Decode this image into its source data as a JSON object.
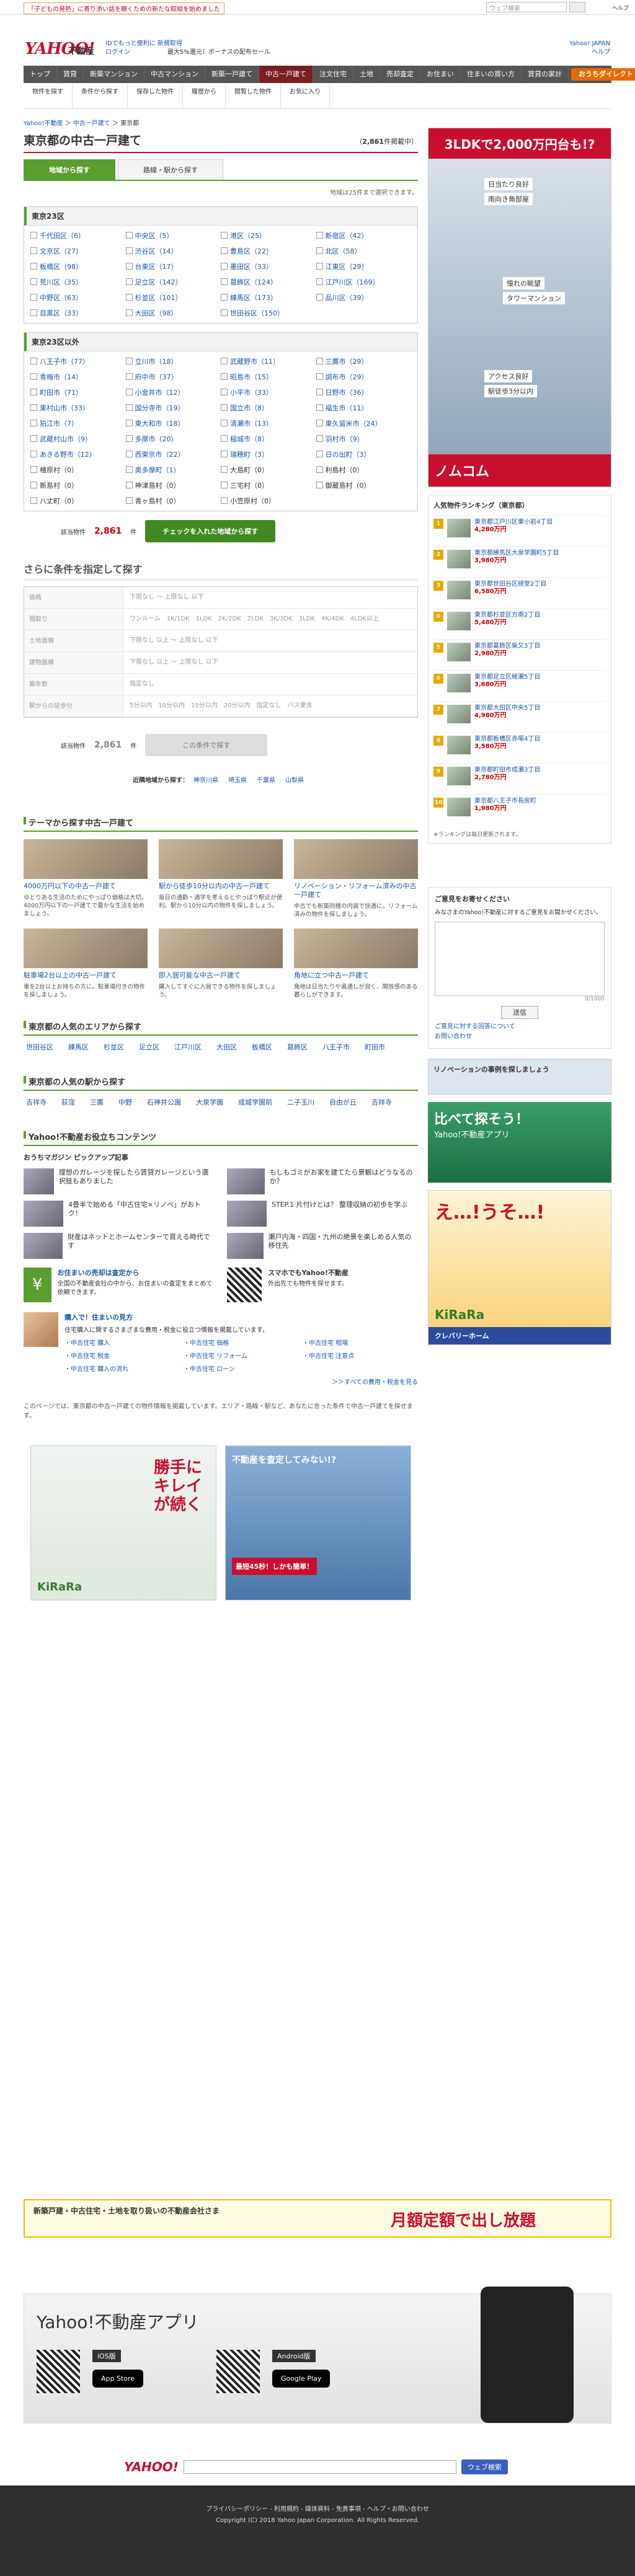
{
  "topbar": {
    "notice": "「子どもの発熱」に寄り添い話を聴くための新たな取組を始めました",
    "search_placeholder": "ウェブ検索",
    "yahoo_japan": "Yahoo! JAPAN",
    "help": "ヘルプ"
  },
  "header": {
    "logo": "YAHOO!",
    "logo_sub": "不動産",
    "logo_japan": "JAPAN",
    "login_text": "IDでもっと便利に 新規取得",
    "login": "ログイン",
    "promo": "最大5%還元！ボーナスの配布セール"
  },
  "nav": {
    "items": [
      "トップ",
      "賃貸",
      "新築マンション",
      "中古マンション",
      "新築一戸建て",
      "中古一戸建て",
      "注文住宅",
      "土地",
      "売却査定",
      "お住まい",
      "住まいの買い方",
      "賃貸の家計"
    ],
    "active_index": 5,
    "pill": "おうちダイレクト"
  },
  "subnav": {
    "items": [
      "物件を探す",
      "条件から探す",
      "保存した物件",
      "履歴から",
      "閲覧した物件",
      "お気に入り"
    ]
  },
  "breadcrumb": {
    "items": [
      "Yahoo!不動産",
      "中古一戸建て",
      "東京都"
    ]
  },
  "page": {
    "title": "東京都の中古一戸建て",
    "count_prefix": "（",
    "count": "2,861",
    "count_suffix": "件掲載中）",
    "tab_area": "地域から探す",
    "tab_line": "路線・駅から探す",
    "hint": "地域は25件まで選択できます。"
  },
  "wards": {
    "heading": "東京23区",
    "items": [
      "千代田区（6）",
      "中央区（5）",
      "港区（25）",
      "新宿区（42）",
      "文京区（27）",
      "渋谷区（14）",
      "豊島区（22）",
      "北区（58）",
      "板橋区（98）",
      "台東区（17）",
      "墨田区（33）",
      "江東区（29）",
      "荒川区（35）",
      "足立区（142）",
      "葛飾区（124）",
      "江戸川区（169）",
      "中野区（63）",
      "杉並区（101）",
      "練馬区（173）",
      "品川区（39）",
      "目黒区（33）",
      "大田区（98）",
      "世田谷区（150）",
      ""
    ]
  },
  "cities": {
    "heading": "東京23区以外",
    "items": [
      "八王子市（77）",
      "立川市（18）",
      "武蔵野市（11）",
      "三鷹市（29）",
      "青梅市（14）",
      "府中市（37）",
      "昭島市（15）",
      "調布市（29）",
      "町田市（71）",
      "小金井市（12）",
      "小平市（33）",
      "日野市（36）",
      "東村山市（33）",
      "国分寺市（19）",
      "国立市（8）",
      "福生市（11）",
      "狛江市（7）",
      "東大和市（18）",
      "清瀬市（13）",
      "東久留米市（24）",
      "武蔵村山市（9）",
      "多摩市（20）",
      "稲城市（8）",
      "羽村市（9）",
      "あきる野市（12）",
      "西東京市（22）",
      "瑞穂町（3）",
      "日の出町（3）",
      "檜原村（0）",
      "奥多摩町（1）",
      "大島町（0）",
      "利島村（0）",
      "新島村（0）",
      "神津島村（0）",
      "三宅村（0）",
      "御蔵島村（0）",
      "八丈町（0）",
      "青ヶ島村（0）",
      "小笠原村（0）",
      ""
    ]
  },
  "search_bar": {
    "label": "該当物件",
    "count": "2,861",
    "unit": "件",
    "button": "チェックを入れた地域から探す"
  },
  "conditions": {
    "heading": "さらに条件を指定して探す",
    "rows": [
      {
        "label": "価格",
        "value": "下限なし 〜 上限なし 以下"
      },
      {
        "label": "間取り",
        "value": "ワンルーム　1K/1DK　1LDK　2K/2DK　2LDK　3K/3DK　3LDK　4K/4DK　4LDK以上"
      },
      {
        "label": "土地面積",
        "value": "下限なし 以上 〜 上限なし 以下"
      },
      {
        "label": "建物面積",
        "value": "下限なし 以上 〜 上限なし 以下"
      },
      {
        "label": "築年数",
        "value": "指定なし"
      },
      {
        "label": "駅からの徒歩分",
        "value": "5分以内　10分以内　15分以内　20分以内　指定なし　バス便含"
      }
    ],
    "total_label": "該当物件",
    "total_count": "2,861",
    "total_unit": "件",
    "button": "この条件で探す"
  },
  "neighbor": {
    "label": "近隣地域から探す",
    "items": [
      "神奈川県",
      "埼玉県",
      "千葉県",
      "山梨県"
    ]
  },
  "themes": {
    "heading": "テーマから探す中古一戸建て",
    "items": [
      {
        "title": "4000万円以下の中古一戸建て",
        "desc": "ゆとりある生活のためにやっぱり価格は大切。4000万円以下の一戸建てで豊かな生活を始めましょう。"
      },
      {
        "title": "駅から徒歩10分以内の中古一戸建て",
        "desc": "毎日の通勤・通学を考えるとやっぱり駅近が便利。駅から10分以内の物件を探しましょう。"
      },
      {
        "title": "リノベーション・リフォーム済みの中古一戸建て",
        "desc": "中古でも新築同様の内装で快適に。リフォーム済みの物件を探しましょう。"
      },
      {
        "title": "駐車場2台以上の中古一戸建て",
        "desc": "車を2台以上お持ちの方に。駐車場付きの物件を探しましょう。"
      },
      {
        "title": "即入居可能な中古一戸建て",
        "desc": "購入してすぐに入居できる物件を探しましょう。"
      },
      {
        "title": "角地に立つ中古一戸建て",
        "desc": "角地は日当たりや風通しが良く、開放感のある暮らしができます。"
      }
    ]
  },
  "popular_area": {
    "heading": "東京都の人気のエリアから探す",
    "items": [
      "世田谷区",
      "練馬区",
      "杉並区",
      "足立区",
      "江戸川区",
      "大田区",
      "板橋区",
      "葛飾区",
      "八王子市",
      "町田市"
    ]
  },
  "popular_station": {
    "heading": "東京都の人気の駅から探す",
    "items": [
      "吉祥寺",
      "荻窪",
      "三鷹",
      "中野",
      "石神井公園",
      "大泉学園",
      "成城学園前",
      "二子玉川",
      "自由が丘",
      "吉祥寺"
    ]
  },
  "contents": {
    "heading": "Yahoo!不動産お役立ちコンテンツ",
    "pickup_heading": "おうちマガジン ピックアップ記事",
    "pickup": [
      "理想のガレージを探したら賃貸ガレージという選択肢もありました",
      "もしもゴミがお家を建てたら景観はどうなるのか？",
      "4畳半で始める「中古住宅×リノベ」がおトク！",
      "STEP.1 片付けとは？ 整理収納の初歩を学ぶ",
      "財産はネットとホームセンターで買える時代です",
      "瀬戸内海・四国・九州の絶景を楽しめる人気の移住先"
    ],
    "inquiry_title": "お住まいの売却は査定から",
    "inquiry_desc": "全国の不動産会社の中から、お住まいの査定をまとめて依頼できます。",
    "app_title": "スマホでもYahoo!不動産",
    "app_desc": "外出先でも物件を探せます。",
    "guide_title": "購入で！住まいの見方",
    "guide_desc": "住宅購入に関するさまざまな費用・税金に役立つ情報を掲載しています。",
    "guide_links": [
      "中古住宅 購入",
      "中古住宅 価格",
      "中古住宅 相場",
      "中古住宅 税金",
      "中古住宅 リフォーム",
      "中古住宅 注意点",
      "中古住宅 購入の流れ",
      "中古住宅 ローン"
    ],
    "guide_more": "＞＞すべての費用・税金を見る"
  },
  "about": {
    "text": "このページでは、東京都の中古一戸建ての物件情報を掲載しています。エリア・路線・駅など、あなたに合った条件で中古一戸建てを探せます。"
  },
  "ranking": {
    "heading": "人気物件ランキング（東京都）",
    "items": [
      {
        "rank": "1",
        "name": "東京都江戸川区東小岩4丁目",
        "price": "4,280万円"
      },
      {
        "rank": "2",
        "name": "東京都練馬区大泉学園町5丁目",
        "price": "3,980万円"
      },
      {
        "rank": "3",
        "name": "東京都世田谷区経堂2丁目",
        "price": "6,580万円"
      },
      {
        "rank": "4",
        "name": "東京都杉並区方南2丁目",
        "price": "5,480万円"
      },
      {
        "rank": "5",
        "name": "東京都葛飾区柴又3丁目",
        "price": "2,980万円"
      },
      {
        "rank": "6",
        "name": "東京都足立区綾瀬5丁目",
        "price": "3,680万円"
      },
      {
        "rank": "7",
        "name": "東京都大田区中央5丁目",
        "price": "4,980万円"
      },
      {
        "rank": "8",
        "name": "東京都板橋区赤塚4丁目",
        "price": "3,580万円"
      },
      {
        "rank": "9",
        "name": "東京都町田市成瀬3丁目",
        "price": "2,780万円"
      },
      {
        "rank": "10",
        "name": "東京都八王子市長房町",
        "price": "1,980万円"
      }
    ],
    "note": "※ランキングは毎日更新されます。"
  },
  "feedback": {
    "heading": "ご意見をお寄せください",
    "desc": "みなさまのYahoo!不動産に対するご意見をお聞かせください。",
    "count": "0/1000",
    "button": "送信",
    "links": [
      "ご意見に対する回答について",
      "お問い合わせ"
    ]
  },
  "ads": {
    "nomu_headline": "3LDKで2,000万円台も!?",
    "nomu_tag1": "日当たり良好",
    "nomu_tag2": "南向き角部屋",
    "nomu_tag3": "憧れの眺望",
    "nomu_tag4": "タワーマンション",
    "nomu_tag5": "アクセス良好",
    "nomu_tag6": "駅徒歩3分以内",
    "nomu_logo": "ノムコム",
    "reno_text": "リノベーションの事例を探しましょう",
    "app_small": "比べて探そう！",
    "app_small2": "Yahoo!不動産アプリ",
    "kirara1": "え…!うそ…!",
    "kirara_brand": "KiRaRa",
    "kurevi": "クレバリーホーム",
    "big_left": "勝手にキレイが続く",
    "big_right": "不動産を査定してみない!?",
    "big_right_sub": "最短45秒！しかも簡単！",
    "banner_wide": "新築戸建・中古住宅・土地を取り扱いの不動産会社さま",
    "banner_wide2": "月額定額で出し放題",
    "app_banner_title": "Yahoo!不動産アプリ",
    "ios": "iOS版",
    "android": "Android版",
    "appstore": "App Store",
    "googleplay": "Google Play"
  },
  "footer": {
    "search_button": "ウェブ検索",
    "links": "プライバシーポリシー - 利用規約 - 媒体資料 - 免責事項 - ヘルプ・お問い合わせ",
    "copyright": "Copyright (C) 2018 Yahoo Japan Corporation. All Rights Reserved."
  }
}
